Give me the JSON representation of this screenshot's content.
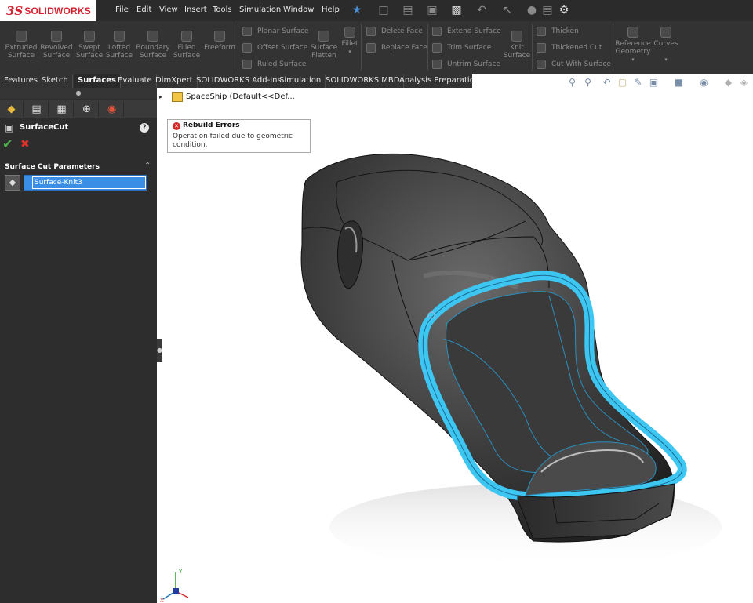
{
  "app": {
    "brand": "SOLIDWORKS",
    "logo_mark": "3S"
  },
  "menu": [
    "File",
    "Edit",
    "View",
    "Insert",
    "Tools",
    "Simulation",
    "Window",
    "Help"
  ],
  "quick_access_icons": [
    "pin-icon",
    "new-icon",
    "open-icon",
    "save-icon",
    "print-icon",
    "undo-icon",
    "select-icon",
    "rebuild-icon",
    "file-properties-icon",
    "options-icon"
  ],
  "ribbon": {
    "large_buttons": [
      {
        "label": "Extruded Surface",
        "line1": "Extruded",
        "line2": "Surface"
      },
      {
        "label": "Revolved Surface",
        "line1": "Revolved",
        "line2": "Surface"
      },
      {
        "label": "Swept Surface",
        "line1": "Swept",
        "line2": "Surface"
      },
      {
        "label": "Lofted Surface",
        "line1": "Lofted",
        "line2": "Surface"
      },
      {
        "label": "Boundary Surface",
        "line1": "Boundary",
        "line2": "Surface"
      },
      {
        "label": "Filled Surface",
        "line1": "Filled",
        "line2": "Surface"
      },
      {
        "label": "Freeform",
        "line1": "Freeform",
        "line2": ""
      }
    ],
    "group1": [
      "Planar Surface",
      "Offset Surface",
      "Ruled Surface"
    ],
    "surface_flatten": {
      "line1": "Surface",
      "line2": "Flatten"
    },
    "fillet": "Fillet",
    "group2": [
      "Delete Face",
      "Replace Face"
    ],
    "group3": [
      "Extend Surface",
      "Trim Surface",
      "Untrim Surface"
    ],
    "knit_surface": {
      "line1": "Knit",
      "line2": "Surface"
    },
    "group4": [
      "Thicken",
      "Thickened Cut",
      "Cut With Surface"
    ],
    "reference_geometry": {
      "line1": "Reference",
      "line2": "Geometry"
    },
    "curves": "Curves"
  },
  "tabs": [
    "Features",
    "Sketch",
    "Surfaces",
    "Evaluate",
    "DimXpert",
    "SOLIDWORKS Add-Ins",
    "Simulation",
    "SOLIDWORKS MBD",
    "Analysis Preparation"
  ],
  "active_tab": "Surfaces",
  "property_manager": {
    "title": "SurfaceCut",
    "section_title": "Surface Cut Parameters",
    "selected_surface": "Surface-Knit3"
  },
  "feature_tree": {
    "root_label": "SpaceShip  (Default<<Def..."
  },
  "error_tooltip": {
    "title": "Rebuild Errors",
    "message": "Operation failed due to geometric condition."
  },
  "colors": {
    "highlight_cyan": "#3ec6f2",
    "error_red": "#d22a2a",
    "ok_green": "#4fb34f",
    "selection_blue": "#3a8ee6"
  }
}
